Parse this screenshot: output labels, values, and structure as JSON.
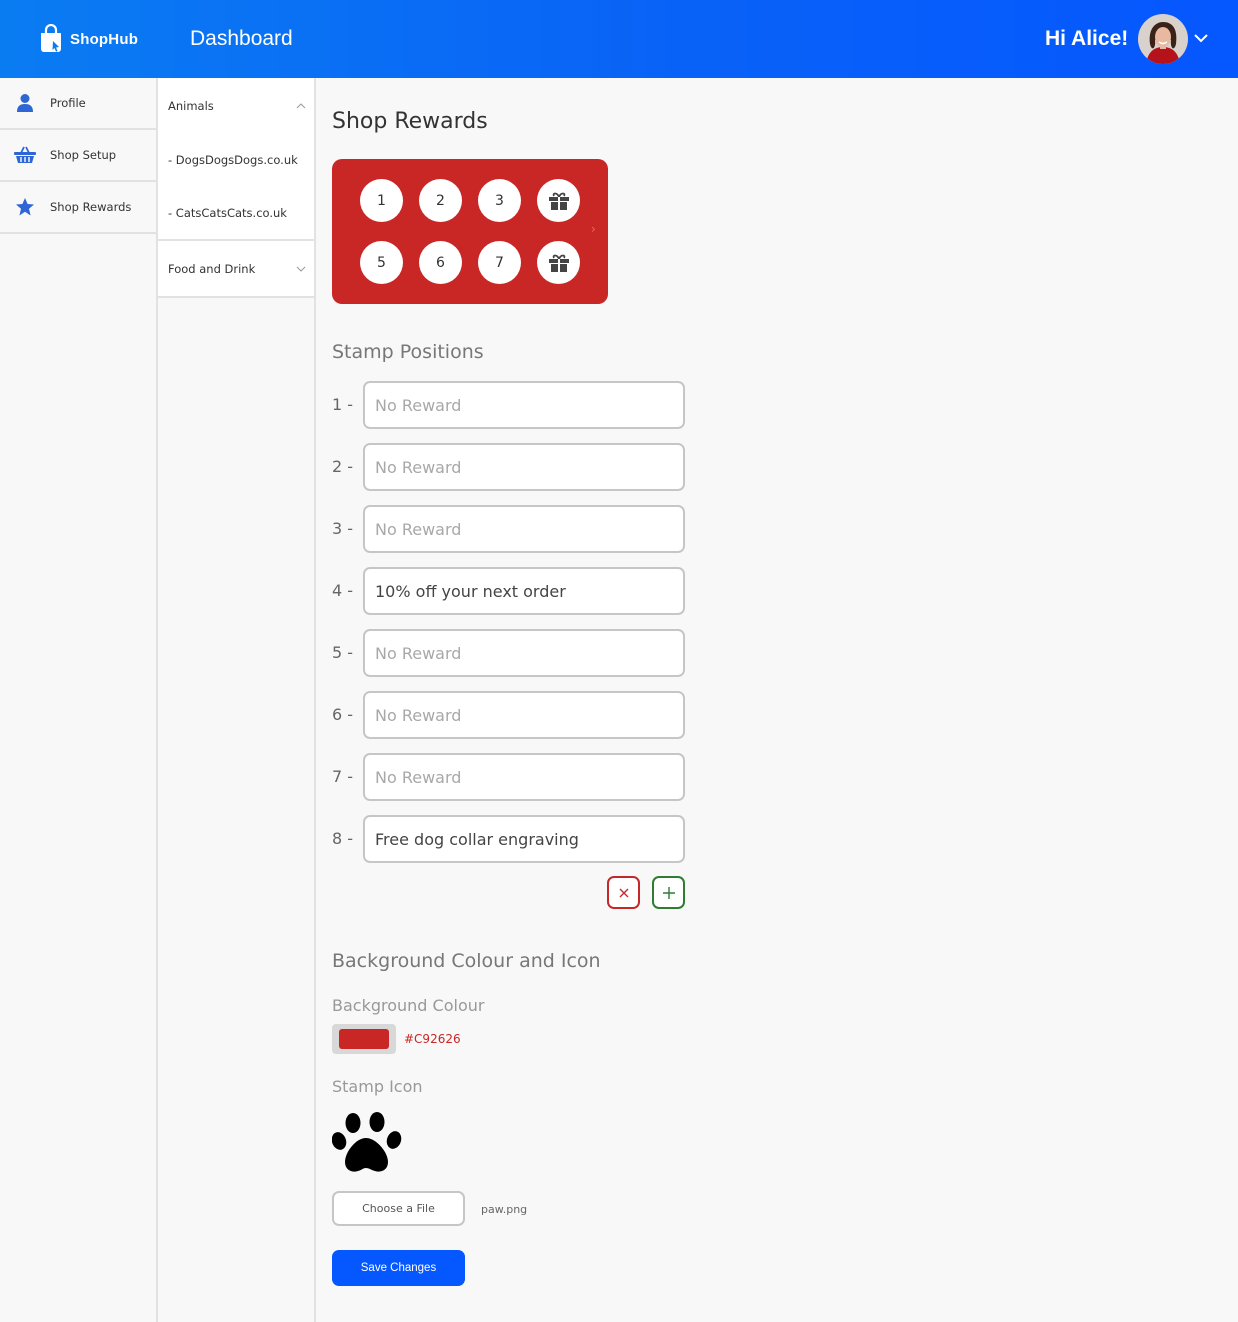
{
  "header": {
    "brand": "ShopHub",
    "title": "Dashboard",
    "greeting": "Hi Alice!"
  },
  "sidebar": {
    "items": [
      {
        "label": "Profile",
        "icon": "user-icon"
      },
      {
        "label": "Shop Setup",
        "icon": "basket-icon"
      },
      {
        "label": "Shop Rewards",
        "icon": "star-icon"
      }
    ]
  },
  "subnav": {
    "groups": [
      {
        "label": "Animals",
        "expanded": true,
        "links": [
          "- DogsDogsDogs.co.uk",
          "- CatsCatsCats.co.uk"
        ]
      },
      {
        "label": "Food and Drink",
        "expanded": false,
        "links": []
      }
    ]
  },
  "main": {
    "title": "Shop Rewards",
    "card": {
      "stamps_row1": [
        "1",
        "2",
        "3",
        "gift"
      ],
      "stamps_row2": [
        "5",
        "6",
        "7",
        "gift"
      ],
      "arrow": "›"
    },
    "stamp_positions": {
      "title": "Stamp Positions",
      "placeholder": "No Reward",
      "rows": [
        {
          "num": "1 -",
          "value": ""
        },
        {
          "num": "2 -",
          "value": ""
        },
        {
          "num": "3 -",
          "value": ""
        },
        {
          "num": "4 -",
          "value": "10% off your next order"
        },
        {
          "num": "5 -",
          "value": ""
        },
        {
          "num": "6 -",
          "value": ""
        },
        {
          "num": "7 -",
          "value": ""
        },
        {
          "num": "8 -",
          "value": "Free dog collar engraving"
        }
      ]
    },
    "appearance": {
      "title": "Background Colour and Icon",
      "bg_label": "Background Colour",
      "bg_color": "#C92626",
      "icon_label": "Stamp Icon",
      "choose_file": "Choose a File",
      "file_name": "paw.png",
      "save": "Save Changes"
    }
  },
  "colors": {
    "accent": "#0557ff",
    "card_bg": "#C92626",
    "remove": "#c62828",
    "add": "#2e7d32"
  }
}
